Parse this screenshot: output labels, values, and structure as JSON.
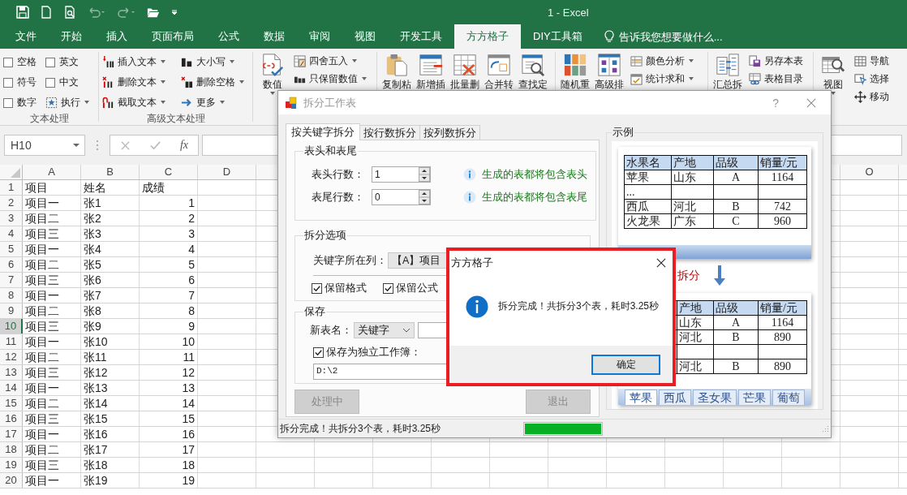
{
  "title_bar": {
    "title": "1 - Excel"
  },
  "menu_tabs": [
    {
      "label": "文件",
      "selected": false
    },
    {
      "label": "开始",
      "selected": false
    },
    {
      "label": "插入",
      "selected": false
    },
    {
      "label": "页面布局",
      "selected": false
    },
    {
      "label": "公式",
      "selected": false
    },
    {
      "label": "数据",
      "selected": false
    },
    {
      "label": "审阅",
      "selected": false
    },
    {
      "label": "视图",
      "selected": false
    },
    {
      "label": "开发工具",
      "selected": false
    },
    {
      "label": "方方格子",
      "selected": true
    },
    {
      "label": "DIY工具箱",
      "selected": false
    }
  ],
  "tell_me": {
    "placeholder": "告诉我您想要做什么..."
  },
  "ribbon": {
    "text_group": {
      "label": "文本处理",
      "options": [
        {
          "label": "空格",
          "checked": false
        },
        {
          "label": "英文",
          "checked": false
        },
        {
          "label": "符号",
          "checked": false
        },
        {
          "label": "中文",
          "checked": false
        },
        {
          "label": "数字",
          "checked": false
        }
      ],
      "run": "执行"
    },
    "advanced_group": {
      "label": "高级文本处理",
      "items": [
        "插入文本",
        "删除文本",
        "截取文本",
        "大小写",
        "删除空格",
        "更多"
      ]
    },
    "value_button": "数值",
    "value_items": [
      "四舍五入",
      "只保留数值"
    ],
    "tool_buttons": [
      "复制粘",
      "新增插",
      "批量删",
      "合并转",
      "查找定"
    ],
    "sort_buttons": [
      "随机重",
      "高级排"
    ],
    "analysis_items": [
      "颜色分析",
      "统计求和"
    ],
    "summary_button": "汇总拆",
    "sheet_items": [
      "另存本表",
      "表格目录"
    ],
    "view_button": "视图",
    "nav_items": [
      "导航",
      "选择",
      "移动"
    ]
  },
  "formula_bar": {
    "cell": "H10",
    "function_label": "fx"
  },
  "sheet": {
    "left_columns": [
      "A",
      "B",
      "C",
      "D"
    ],
    "right_columns": [
      "O"
    ],
    "rows": [
      {
        "number": "1",
        "selected": false,
        "kind": "heading",
        "cells": [
          "项目",
          "姓名",
          "成绩"
        ]
      },
      {
        "number": "2",
        "selected": false,
        "kind": "record",
        "cells": [
          "项目一",
          "张1",
          "1"
        ]
      },
      {
        "number": "3",
        "selected": false,
        "kind": "record",
        "cells": [
          "项目二",
          "张2",
          "2"
        ]
      },
      {
        "number": "4",
        "selected": false,
        "kind": "record",
        "cells": [
          "项目三",
          "张3",
          "3"
        ]
      },
      {
        "number": "5",
        "selected": false,
        "kind": "record",
        "cells": [
          "项目一",
          "张4",
          "4"
        ]
      },
      {
        "number": "6",
        "selected": false,
        "kind": "record",
        "cells": [
          "项目二",
          "张5",
          "5"
        ]
      },
      {
        "number": "7",
        "selected": false,
        "kind": "record",
        "cells": [
          "项目三",
          "张6",
          "6"
        ]
      },
      {
        "number": "8",
        "selected": false,
        "kind": "record",
        "cells": [
          "项目一",
          "张7",
          "7"
        ]
      },
      {
        "number": "9",
        "selected": false,
        "kind": "record",
        "cells": [
          "项目二",
          "张8",
          "8"
        ]
      },
      {
        "number": "10",
        "selected": true,
        "kind": "record",
        "cells": [
          "项目三",
          "张9",
          "9"
        ]
      },
      {
        "number": "11",
        "selected": false,
        "kind": "record",
        "cells": [
          "项目一",
          "张10",
          "10"
        ]
      },
      {
        "number": "12",
        "selected": false,
        "kind": "record",
        "cells": [
          "项目二",
          "张11",
          "11"
        ]
      },
      {
        "number": "13",
        "selected": false,
        "kind": "record",
        "cells": [
          "项目三",
          "张12",
          "12"
        ]
      },
      {
        "number": "14",
        "selected": false,
        "kind": "record",
        "cells": [
          "项目一",
          "张13",
          "13"
        ]
      },
      {
        "number": "15",
        "selected": false,
        "kind": "record",
        "cells": [
          "项目二",
          "张14",
          "14"
        ]
      },
      {
        "number": "16",
        "selected": false,
        "kind": "record",
        "cells": [
          "项目三",
          "张15",
          "15"
        ]
      },
      {
        "number": "17",
        "selected": false,
        "kind": "record",
        "cells": [
          "项目一",
          "张16",
          "16"
        ]
      },
      {
        "number": "18",
        "selected": false,
        "kind": "record",
        "cells": [
          "项目二",
          "张17",
          "17"
        ]
      },
      {
        "number": "19",
        "selected": false,
        "kind": "record",
        "cells": [
          "项目三",
          "张18",
          "18"
        ]
      },
      {
        "number": "20",
        "selected": false,
        "kind": "record",
        "cells": [
          "项目一",
          "张19",
          "19"
        ]
      }
    ]
  },
  "dialog": {
    "title": "拆分工作表",
    "help": "?",
    "tabs": [
      {
        "label": "按关键字拆分",
        "selected": true
      },
      {
        "label": "按行数拆分",
        "selected": false
      },
      {
        "label": "按列数拆分",
        "selected": false
      }
    ],
    "header_footer": {
      "title": "表头和表尾",
      "fields": [
        {
          "label": "表头行数：",
          "value": "1",
          "hint": "生成的表都将包含表头"
        },
        {
          "label": "表尾行数：",
          "value": "0",
          "hint": "生成的表都将包含表尾"
        }
      ]
    },
    "options": {
      "title": "拆分选项",
      "key_column_label": "关键字所在列：",
      "key_column": "【A】项目",
      "checks": [
        {
          "label": "保留格式",
          "checked": true
        },
        {
          "label": "保留公式",
          "checked": true
        }
      ]
    },
    "save": {
      "title": "保存",
      "name_label": "新表名：",
      "name_source": "关键字",
      "standalone": {
        "label": "保存为独立工作簿：",
        "checked": true
      },
      "path": "D:\\2"
    },
    "buttons": [
      {
        "label": "处理中",
        "disabled": true
      },
      {
        "label": "退出",
        "disabled": true
      }
    ],
    "status": "拆分完成！共拆分3个表，耗时3.25秒",
    "progress": {
      "level": 1
    },
    "example": {
      "title": "示例",
      "source": {
        "columns": [
          "水果名",
          "产地",
          "品级",
          "销量/元"
        ],
        "rows": [
          {
            "kind": "record",
            "cells": [
              "苹果",
              "山东",
              "A",
              "1164"
            ]
          },
          {
            "kind": "record",
            "cells": [
              "..."
            ]
          },
          {
            "kind": "record",
            "cells": [
              "西瓜",
              "河北",
              "B",
              "742"
            ]
          },
          {
            "kind": "record",
            "cells": [
              "火龙果",
              "广东",
              "C",
              "960"
            ]
          }
        ]
      },
      "split_label": "拆分",
      "result": {
        "columns": [
          "产地",
          "品级",
          "销量/元"
        ],
        "rows": [
          {
            "kind": "record",
            "cells": [
              "山东",
              "A",
              "1164"
            ]
          },
          {
            "kind": "record",
            "cells": [
              "河北",
              "B",
              "890"
            ]
          },
          {
            "kind": "gap"
          },
          {
            "kind": "record",
            "cells": [
              "河北",
              "B",
              "890"
            ]
          }
        ],
        "sheet_tabs": [
          {
            "label": "苹果",
            "selected": true
          },
          {
            "label": "西瓜",
            "selected": false
          },
          {
            "label": "圣女果",
            "selected": false
          },
          {
            "label": "芒果",
            "selected": false
          },
          {
            "label": "葡萄",
            "selected": false
          }
        ]
      }
    }
  },
  "message_box": {
    "title": "方方格子",
    "message": "拆分完成！共拆分3个表，耗时3.25秒",
    "button": "确定",
    "highlighted": true
  }
}
